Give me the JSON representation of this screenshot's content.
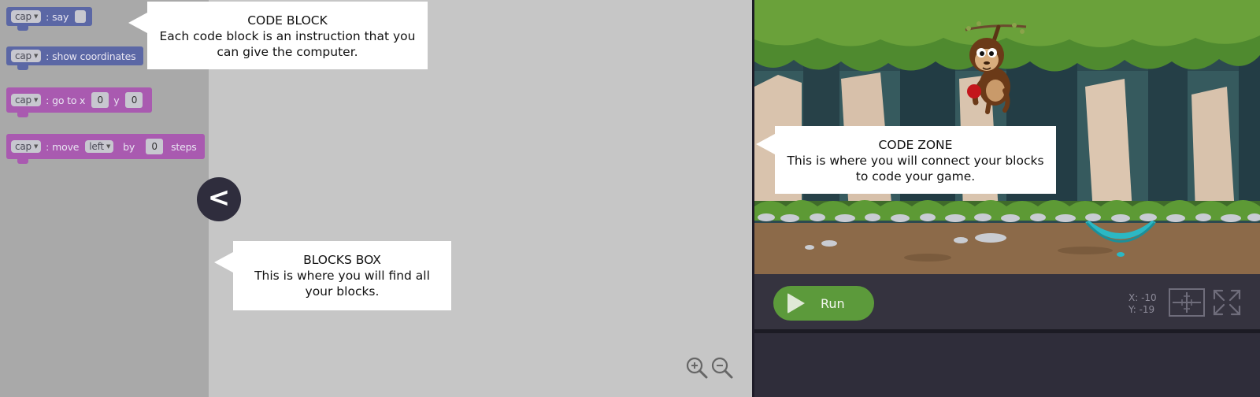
{
  "palette": {
    "blocks": [
      {
        "sprite": "cap",
        "label": "say"
      },
      {
        "sprite": "cap",
        "label": "show coordinates"
      },
      {
        "sprite": "cap",
        "label": "go to x",
        "x_value": "0",
        "y_label": "y",
        "y_value": "0"
      },
      {
        "sprite": "cap",
        "label": "move",
        "direction": "left",
        "by_label": "by",
        "steps_value": "0",
        "steps_label": "steps"
      }
    ],
    "separator": ":"
  },
  "collapse_button": {
    "label": "<"
  },
  "tooltips": {
    "code_block": {
      "title": "CODE BLOCK",
      "body": "Each code block is an instruction that you can give the computer."
    },
    "code_zone": {
      "title": "CODE ZONE",
      "body": "This is where you will connect your blocks to code your game."
    },
    "blocks_box": {
      "title": "BLOCKS BOX",
      "body": "This is where you will find all your blocks."
    }
  },
  "stage": {
    "run_label": "Run",
    "x_readout": "X: -10",
    "y_readout": "Y: -19"
  },
  "icons": {
    "zoom_in": "zoom-in-icon",
    "zoom_out": "zoom-out-icon",
    "center": "crosshair-icon",
    "fullscreen": "fullscreen-icon",
    "play": "play-icon",
    "dropdown": "dropdown-caret-icon"
  },
  "colors": {
    "blue_block": "#5b67a5",
    "purple_block": "#a95ab0",
    "run_green": "#5c9a3b",
    "panel_dark": "#35333f"
  }
}
